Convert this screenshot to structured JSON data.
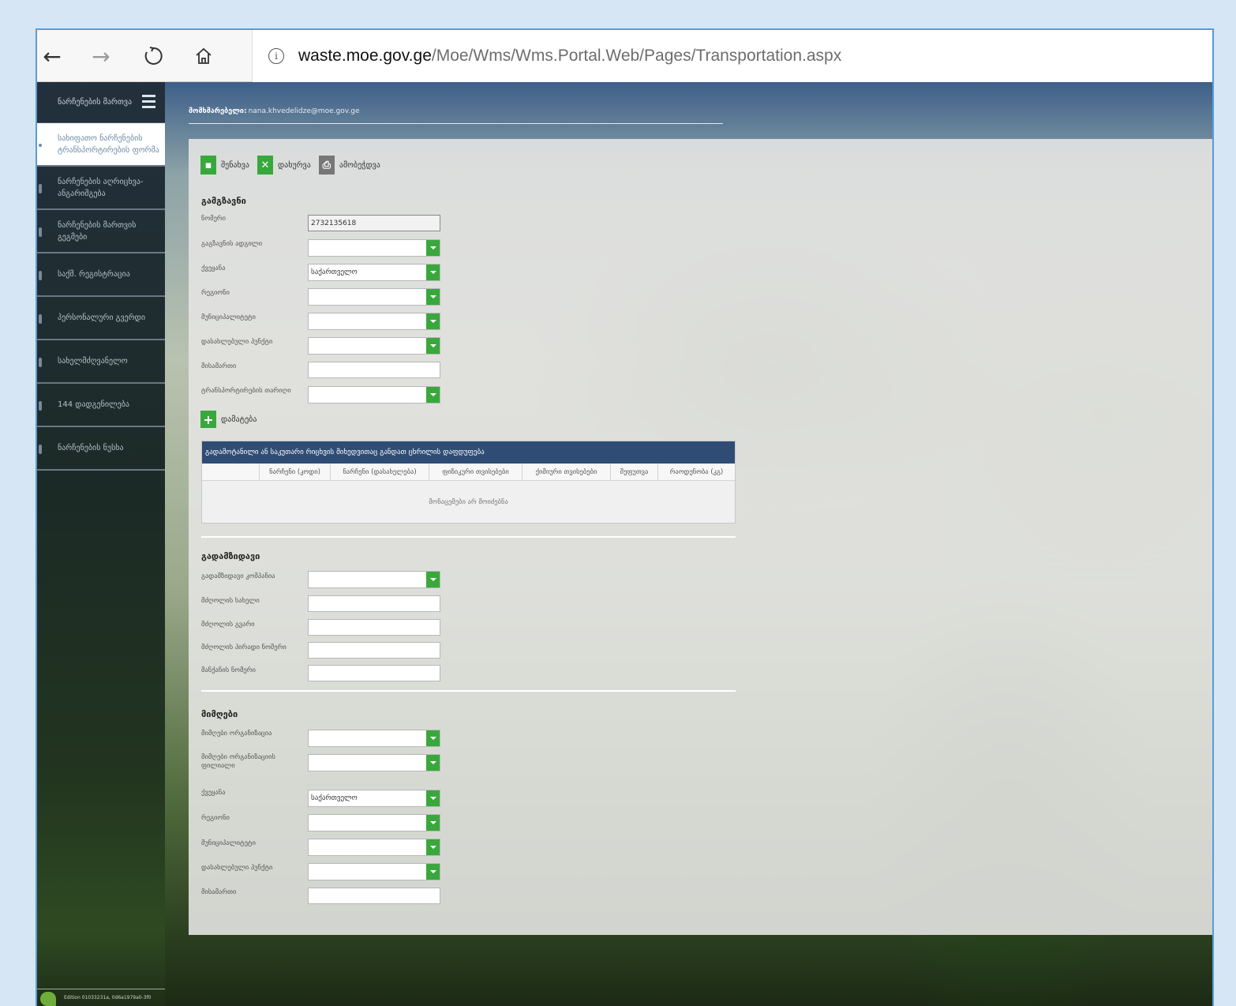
{
  "browser": {
    "back_icon": "arrow-left-icon",
    "forward_icon": "arrow-right-icon",
    "refresh_icon": "refresh-icon",
    "home_icon": "home-icon",
    "url_host": "waste.moe.gov.ge",
    "url_path": "/Moe/Wms/Wms.Portal.Web/Pages/Transportation.aspx"
  },
  "sidebar": {
    "header": "ნარჩენების მართვა",
    "items": [
      {
        "label": "სახიფათო ნარჩენების ტრანსპორტირების ფორმა",
        "active": true
      },
      {
        "label": "ნარჩენების აღრიცხვა-ანგარიშგება",
        "active": false
      },
      {
        "label": "ნარჩენების მართვის გეგმები",
        "active": false
      },
      {
        "label": "საქმ. რეგისტრაცია",
        "active": false
      },
      {
        "label": "პერსონალური გვერდი",
        "active": false
      },
      {
        "label": "სახელმძღვანელო",
        "active": false
      },
      {
        "label": "144 დადგენილება",
        "active": false
      },
      {
        "label": "ნარჩენების ნუსხა",
        "active": false
      }
    ],
    "footer": "Edition 01033231a, 0d6a1979a0-3f0"
  },
  "user": {
    "label": "მომხმარებელი:",
    "email": "nana.khvedelidze@moe.gov.ge"
  },
  "toolbar": {
    "save": "შენახვა",
    "cancel": "დახურვა",
    "print": "ამობეჭდვა"
  },
  "sender": {
    "title": "გამგზავნი",
    "fields": {
      "number_label": "ნომერი",
      "number_value": "2732135618",
      "place_label": "გაგზავნის ადგილი",
      "country_label": "ქვეყანა",
      "country_value": "საქართველო",
      "region_label": "რეგიონი",
      "municipality_label": "მუნიციპალიტეტი",
      "settlement_label": "დასახლებული პუნქტი",
      "address_label": "მისამართი",
      "transport_date_label": "ტრანსპორტირების თარიღი"
    },
    "add_label": "დამატება"
  },
  "grid": {
    "title": "გადამოტანილი ან საკუთარი რიცხვის მიხედვითაც განდათ ცხრილის დაფდუფება",
    "columns": [
      "",
      "ნარჩენი (კოდი)",
      "ნარჩენი (დასახელება)",
      "ფიზიკური თვისებები",
      "ქიმიური თვისებები",
      "შეფუთვა",
      "რაოდენობა (კგ)"
    ],
    "empty_text": "მონაცემები არ მოიძებნა"
  },
  "carrier": {
    "title": "გადამზიდავი",
    "company_label": "გადამზიდავი კომპანია",
    "driver_name_label": "მძღოლის სახელი",
    "driver_surname_label": "მძღოლის გვარი",
    "driver_id_label": "მძღოლის პირადი ნომერი",
    "vehicle_label": "მანქანის ნომერი"
  },
  "receiver": {
    "title": "მიმღები",
    "org_label": "მიმღები ორგანიზაცია",
    "org_branch_label": "მიმღები ორგანიზაციის ფილიალი",
    "country_label": "ქვეყანა",
    "country_value": "საქართველო",
    "region_label": "რეგიონი",
    "municipality_label": "მუნიციპალიტეტი",
    "settlement_label": "დასახლებული პუნქტი",
    "address_label": "მისამართი"
  },
  "colors": {
    "accent_green": "#38a83c",
    "grid_header": "#2f4d74",
    "window_border": "#5b9bd5"
  }
}
